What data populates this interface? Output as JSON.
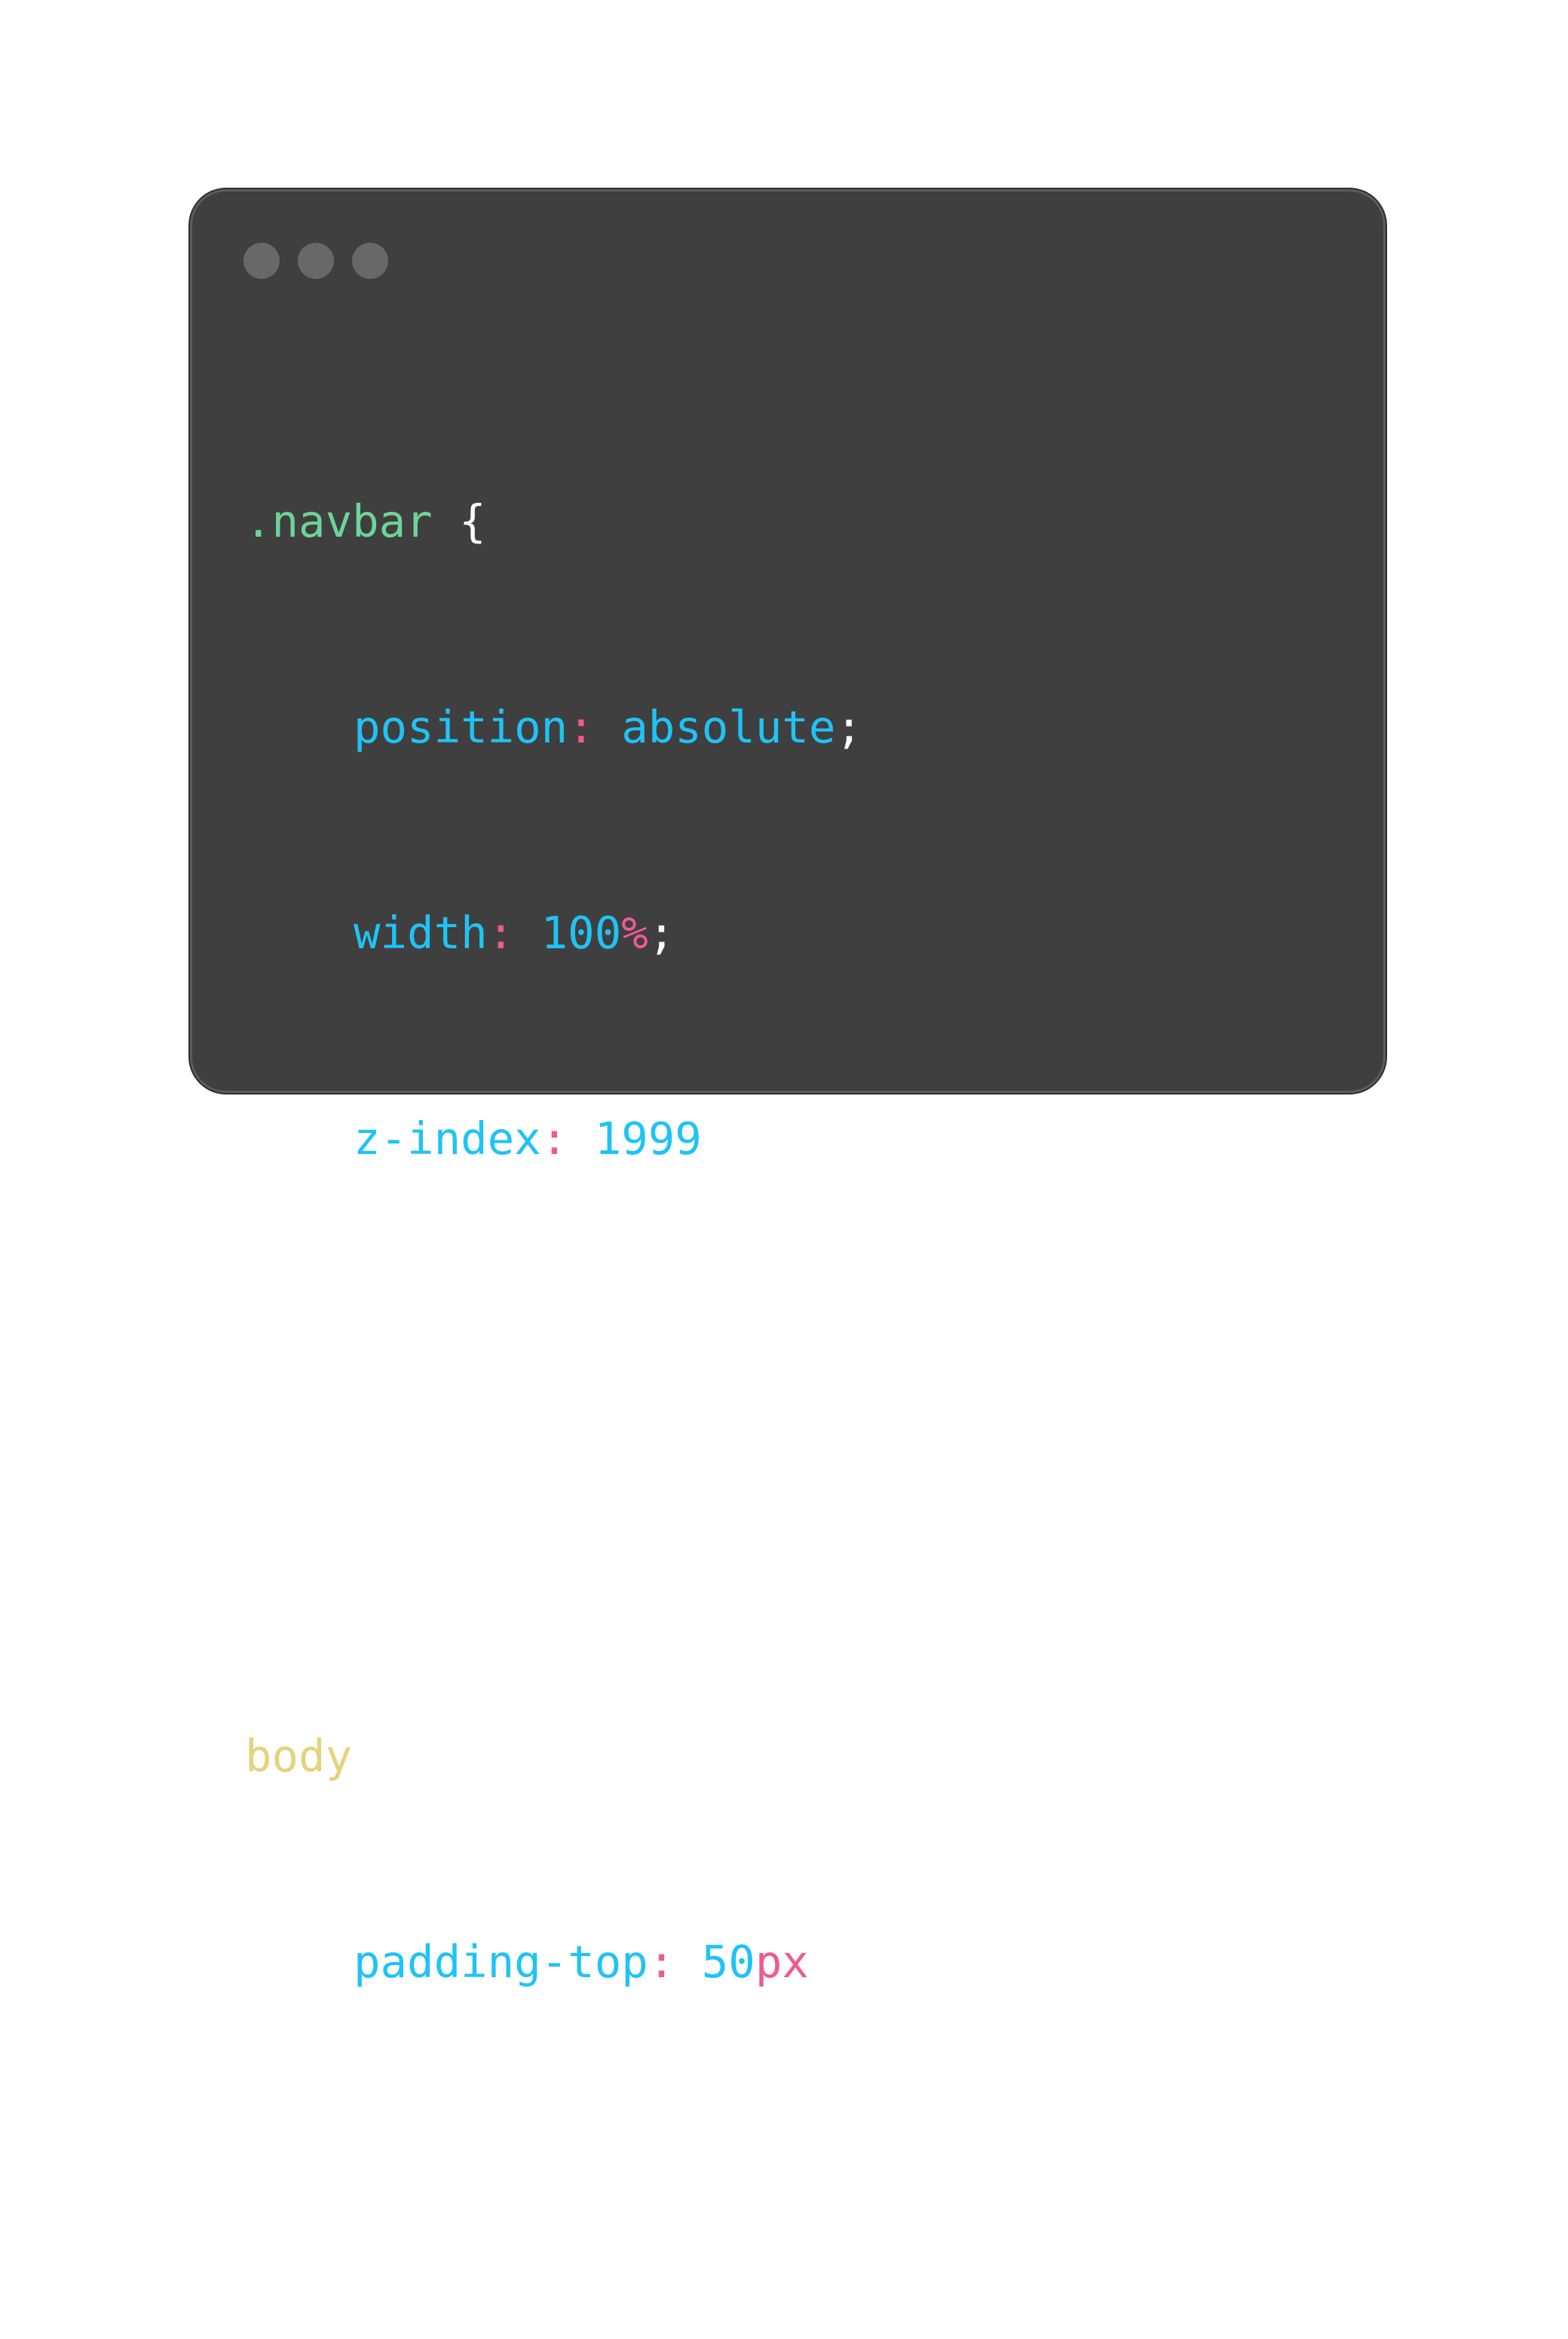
{
  "window": {
    "traffic_lights": [
      "dot",
      "dot",
      "dot"
    ],
    "colors": {
      "background": "#3f3f3f",
      "selector_class": "#6ed39a",
      "selector_tag": "#e3d37c",
      "property": "#1fc3f5",
      "punctuation_colon": "#ef5a92",
      "value": "#1fc3f5",
      "unit": "#ef5a92",
      "brace": "#ffffff"
    }
  },
  "code": {
    "rule1": {
      "selector": ".navbar",
      "open_brace": " {",
      "decl1": {
        "property": "position",
        "colon": ":",
        "value": " absolute",
        "unit": "",
        "semicolon": ";"
      },
      "decl2": {
        "property": "width",
        "colon": ":",
        "value": " 100",
        "unit": "%",
        "semicolon": ";"
      },
      "decl3": {
        "property": "z-index",
        "colon": ":",
        "value": " 1999",
        "unit": "",
        "semicolon": ";"
      },
      "close_brace": "}"
    },
    "rule2": {
      "selector": "body",
      "open_brace": " {",
      "decl1": {
        "property": "padding-top",
        "colon": ":",
        "value": " 50",
        "unit": "px",
        "semicolon": ";"
      },
      "close_brace": "}"
    }
  }
}
